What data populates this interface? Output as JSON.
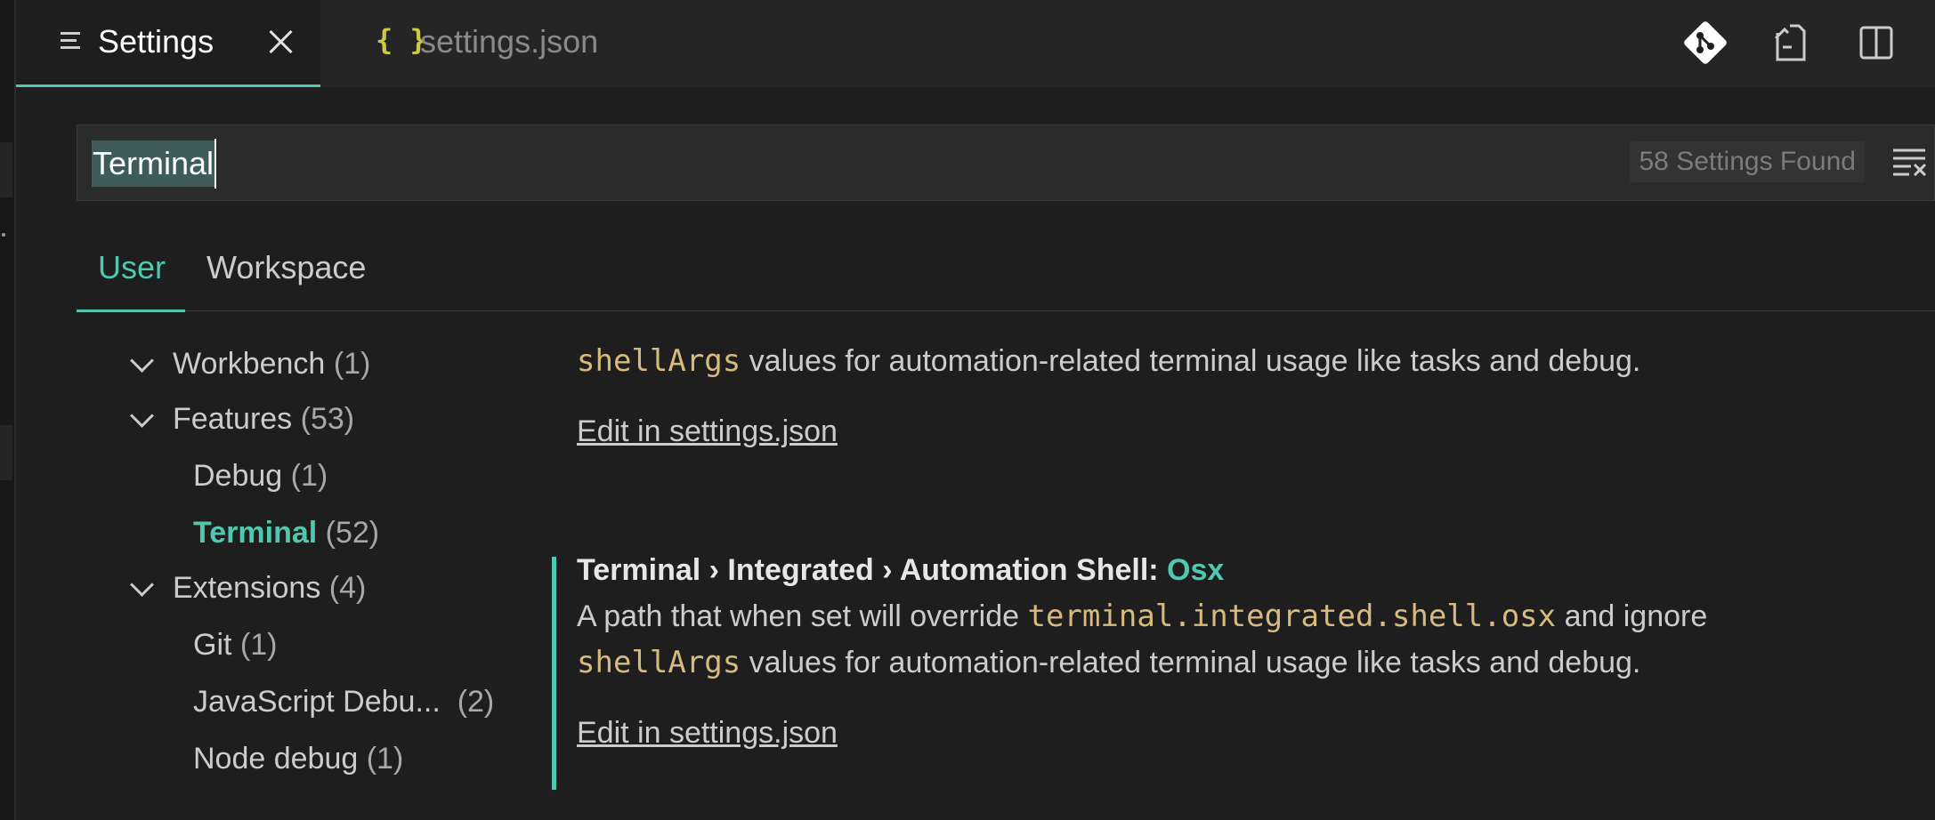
{
  "tabs": {
    "settings_label": "Settings",
    "json_icon": "{ }",
    "json_label": "settings.json"
  },
  "search": {
    "query": "Terminal",
    "result_count": "58 Settings Found"
  },
  "scope_tabs": {
    "user": "User",
    "workspace": "Workspace"
  },
  "toc": {
    "workbench": {
      "label": "Workbench",
      "count": "(1)"
    },
    "features": {
      "label": "Features",
      "count": "(53)"
    },
    "debug": {
      "label": "Debug",
      "count": "(1)"
    },
    "terminal": {
      "label": "Terminal",
      "count": "(52)"
    },
    "extensions": {
      "label": "Extensions",
      "count": "(4)"
    },
    "git": {
      "label": "Git",
      "count": "(1)"
    },
    "js_debug": {
      "label": "JavaScript Debu...",
      "count": "(2)"
    },
    "node_debug": {
      "label": "Node debug",
      "count": "(1)"
    }
  },
  "content": {
    "prev_code": "shellArgs",
    "prev_desc_rest": " values for automation-related terminal usage like tasks and debug.",
    "prev_edit_link": "Edit in settings.json",
    "setting_title_prefix": "Terminal › Integrated › Automation Shell: ",
    "setting_title_key": "Osx",
    "desc_line1_start": "A path that when set will override ",
    "desc_line1_code": "terminal.integrated.shell.osx",
    "desc_line1_end": " and ignore",
    "desc_line2_code": "shellArgs",
    "desc_line2_rest": " values for automation-related terminal usage like tasks and debug.",
    "edit_link": "Edit in settings.json"
  },
  "icons": {
    "tab_settings": "lines-icon",
    "close": "close-icon",
    "git_compare": "git-compare-icon",
    "open_file": "open-file-icon",
    "split_editor": "split-editor-icon",
    "clear_filter": "clear-filter-icon"
  },
  "colors": {
    "accent": "#4ec9b0",
    "code": "#d7ba7d",
    "json_icon": "#cbcb41"
  }
}
